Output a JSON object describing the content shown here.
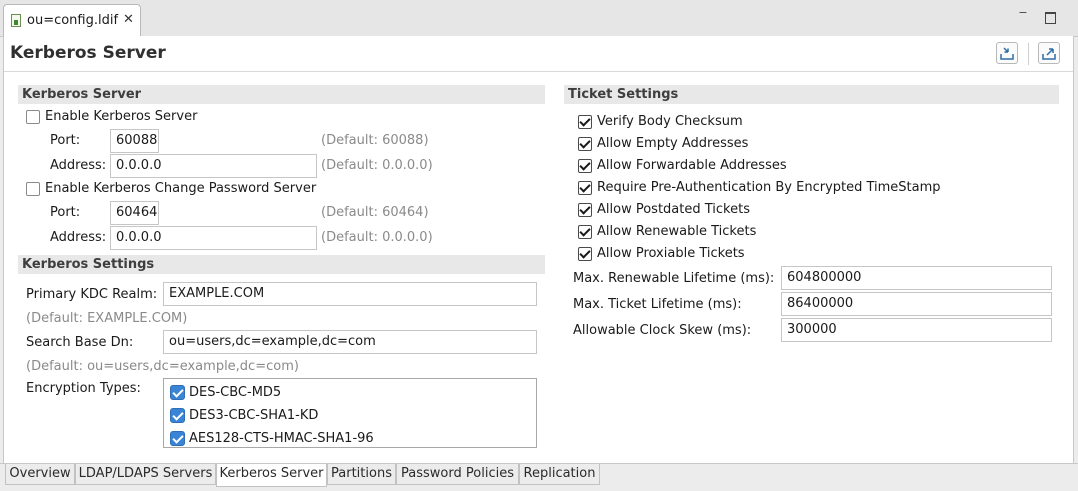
{
  "editor_tab": {
    "title": "ou=config.ldif",
    "close_glyph": "✕"
  },
  "window_controls": {
    "minimize_glyph": "−"
  },
  "page": {
    "title": "Kerberos Server"
  },
  "kerberos_server": {
    "header": "Kerberos Server",
    "enable_server_label": "Enable Kerberos Server",
    "enable_server_checked": false,
    "port_label": "Port:",
    "port_value": "60088",
    "port_default": "(Default: 60088)",
    "address_label": "Address:",
    "address_value": "0.0.0.0",
    "address_default": "(Default: 0.0.0.0)",
    "enable_change_pw_label": "Enable Kerberos Change Password Server",
    "enable_change_pw_checked": false,
    "cpw_port_label": "Port:",
    "cpw_port_value": "60464",
    "cpw_port_default": "(Default: 60464)",
    "cpw_address_label": "Address:",
    "cpw_address_value": "0.0.0.0",
    "cpw_address_default": "(Default: 0.0.0.0)"
  },
  "kerberos_settings": {
    "header": "Kerberos Settings",
    "realm_label": "Primary KDC Realm:",
    "realm_value": "EXAMPLE.COM",
    "realm_default": "(Default: EXAMPLE.COM)",
    "base_dn_label": "Search Base Dn:",
    "base_dn_value": "ou=users,dc=example,dc=com",
    "base_dn_default": "(Default: ou=users,dc=example,dc=com)",
    "encryption_label": "Encryption Types:",
    "encryption_types": [
      {
        "label": "DES-CBC-MD5",
        "checked": true
      },
      {
        "label": "DES3-CBC-SHA1-KD",
        "checked": true
      },
      {
        "label": "AES128-CTS-HMAC-SHA1-96",
        "checked": true
      }
    ]
  },
  "ticket_settings": {
    "header": "Ticket Settings",
    "options": [
      {
        "label": "Verify Body Checksum",
        "checked": true
      },
      {
        "label": "Allow Empty Addresses",
        "checked": true
      },
      {
        "label": "Allow Forwardable Addresses",
        "checked": true
      },
      {
        "label": "Require Pre-Authentication By Encrypted TimeStamp",
        "checked": true
      },
      {
        "label": "Allow Postdated Tickets",
        "checked": true
      },
      {
        "label": "Allow Renewable Tickets",
        "checked": true
      },
      {
        "label": "Allow Proxiable Tickets",
        "checked": true
      }
    ],
    "max_renewable_label": "Max. Renewable Lifetime (ms):",
    "max_renewable_value": "604800000",
    "max_ticket_label": "Max. Ticket Lifetime (ms):",
    "max_ticket_value": "86400000",
    "clock_skew_label": "Allowable Clock Skew (ms):",
    "clock_skew_value": "300000"
  },
  "page_tabs": [
    {
      "label": "Overview",
      "active": false
    },
    {
      "label": "LDAP/LDAPS Servers",
      "active": false
    },
    {
      "label": "Kerberos Server",
      "active": true
    },
    {
      "label": "Partitions",
      "active": false
    },
    {
      "label": "Password Policies",
      "active": false
    },
    {
      "label": "Replication",
      "active": false
    }
  ],
  "icons": {
    "file": "ldif-file-icon",
    "close": "close-icon",
    "minimize": "minimize-icon",
    "maximize": "maximize-icon",
    "import": "import-config-icon",
    "export": "export-config-icon"
  },
  "colors": {
    "checkbox_accent": "#3a84d6",
    "section_header_bg": "#e8e8e8"
  }
}
